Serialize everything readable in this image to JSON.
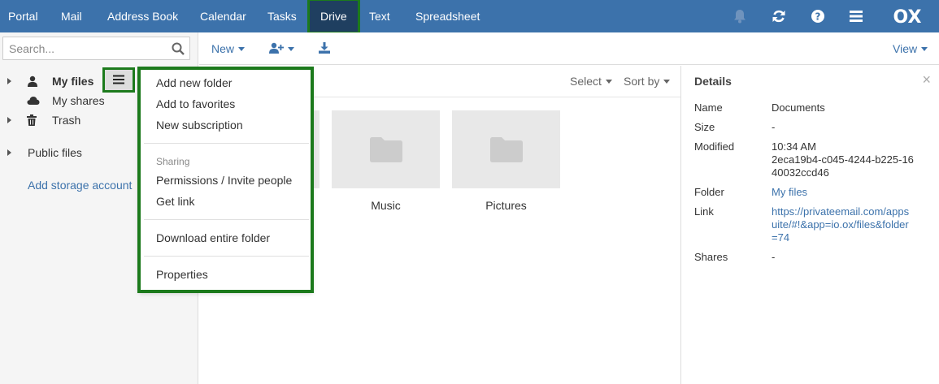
{
  "topbar": {
    "apps": [
      "Portal",
      "Mail",
      "Address Book",
      "Calendar",
      "Tasks",
      "Drive",
      "Text",
      "Spreadsheet"
    ],
    "active_app": "Drive",
    "logo": "OX",
    "icons": [
      "bell-icon",
      "refresh-icon",
      "help-icon",
      "menu-icon"
    ]
  },
  "sidebar": {
    "search_placeholder": "Search...",
    "tree": {
      "my_files": "My files",
      "my_shares": "My shares",
      "trash": "Trash",
      "public_files": "Public files",
      "add_storage": "Add storage account"
    }
  },
  "toolbar": {
    "new_label": "New",
    "view_label": "View"
  },
  "list": {
    "select_label": "Select",
    "sort_label": "Sort by",
    "folders": [
      "Music",
      "Pictures"
    ]
  },
  "context_menu": {
    "add_new_folder": "Add new folder",
    "add_to_favorites": "Add to favorites",
    "new_subscription": "New subscription",
    "sharing_header": "Sharing",
    "permissions": "Permissions / Invite people",
    "get_link": "Get link",
    "download_folder": "Download entire folder",
    "properties": "Properties"
  },
  "details": {
    "title": "Details",
    "close": "×",
    "name_label": "Name",
    "name_value": "Documents",
    "size_label": "Size",
    "size_value": "-",
    "modified_label": "Modified",
    "modified_value": "10:34 AM",
    "id_value": "2eca19b4-c045-4244-b225-1640032ccd46",
    "folder_label": "Folder",
    "folder_value": "My files",
    "link_label": "Link",
    "link_value": "https://privateemail.com/appsuite/#!&app=io.ox/files&folder=74",
    "shares_label": "Shares",
    "shares_value": "-"
  },
  "colors": {
    "topbar": "#3c72ab",
    "active_app": "#1f3f60",
    "highlight": "#1c7a1c",
    "link": "#3c72ab"
  }
}
